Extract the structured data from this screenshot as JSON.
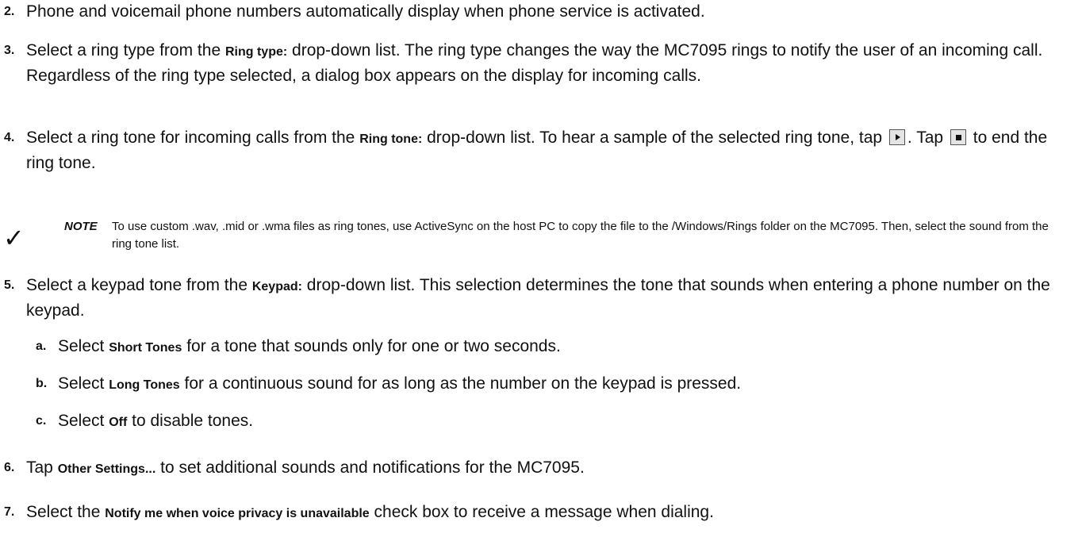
{
  "steps": {
    "s2": {
      "num": "2.",
      "text": "Phone and voicemail phone numbers automatically display when phone service is activated."
    },
    "s3": {
      "num": "3.",
      "pre": "Select a ring type from the ",
      "ui": "Ring type:",
      "post": " drop-down list. The ring type changes the way the MC7095 rings to notify the user of an incoming call. Regardless of the ring type selected, a dialog box appears on the display for incoming calls."
    },
    "s4": {
      "num": "4.",
      "pre": "Select a ring tone for incoming calls from the ",
      "ui": "Ring tone:",
      "mid": " drop-down list. To hear a sample of the selected ring tone, tap ",
      "mid2": ". Tap ",
      "post": " to end the ring tone."
    },
    "s5": {
      "num": "5.",
      "pre": "Select a keypad tone from the ",
      "ui": "Keypad:",
      "post": " drop-down list. This selection determines the tone that sounds when entering a phone number on the keypad."
    },
    "s5a": {
      "letter": "a.",
      "pre": "Select ",
      "ui": "Short Tones",
      "post": " for a tone that sounds only for one or two seconds."
    },
    "s5b": {
      "letter": "b.",
      "pre": "Select ",
      "ui": "Long Tones",
      "post": " for a continuous sound for as long as the number on the keypad is pressed."
    },
    "s5c": {
      "letter": "c.",
      "pre": "Select ",
      "ui": "Off",
      "post": " to disable tones."
    },
    "s6": {
      "num": "6.",
      "pre": "Tap ",
      "ui": "Other Settings...",
      "post": " to set additional sounds and notifications for the MC7095."
    },
    "s7": {
      "num": "7.",
      "pre": "Select the ",
      "ui": "Notify me when voice privacy is unavailable",
      "post": " check box to receive a message when dialing."
    }
  },
  "note": {
    "label": "NOTE",
    "text": "To use custom .wav, .mid or .wma files as ring tones, use ActiveSync on the host PC to copy the file to the /Windows/Rings folder on the MC7095. Then, select the sound from the ring tone list."
  },
  "icons": {
    "note": "checkmark-icon",
    "play": "play-button-icon",
    "stop": "stop-button-icon"
  }
}
